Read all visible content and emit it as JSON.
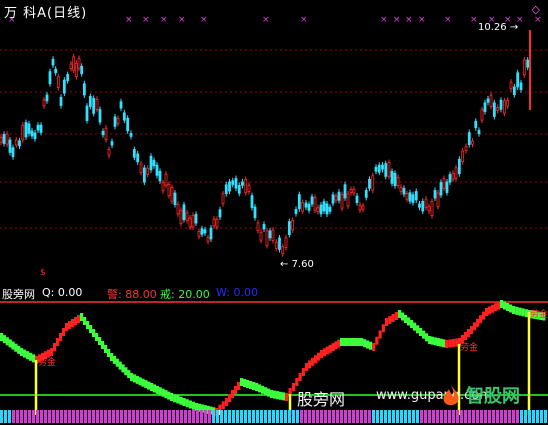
{
  "header": {
    "title": "万 科A(日线)",
    "corner_icon": "◇"
  },
  "price_chart": {
    "high_label": "10.26",
    "low_label": "7.60",
    "series_colors": {
      "up": "#ff2a2a",
      "down": "#33e0ff",
      "grid": "#a00000"
    }
  },
  "indicator": {
    "name": "股旁网",
    "q_label": "Q:",
    "q_value": "0.00",
    "warn_label": "警:",
    "warn_value": "88.00",
    "guard_label": "戒:",
    "guard_value": "20.00",
    "w_label": "W:",
    "w_value": "0.00",
    "signal_text": "劳金",
    "colors": {
      "warn": "#ff3030",
      "guard": "#33ff33",
      "w": "#2a2aff",
      "q": "#ffffff"
    }
  },
  "watermarks": {
    "site_text": "股旁网",
    "url_text": "www.gupang.com",
    "brand": "智股网"
  }
}
